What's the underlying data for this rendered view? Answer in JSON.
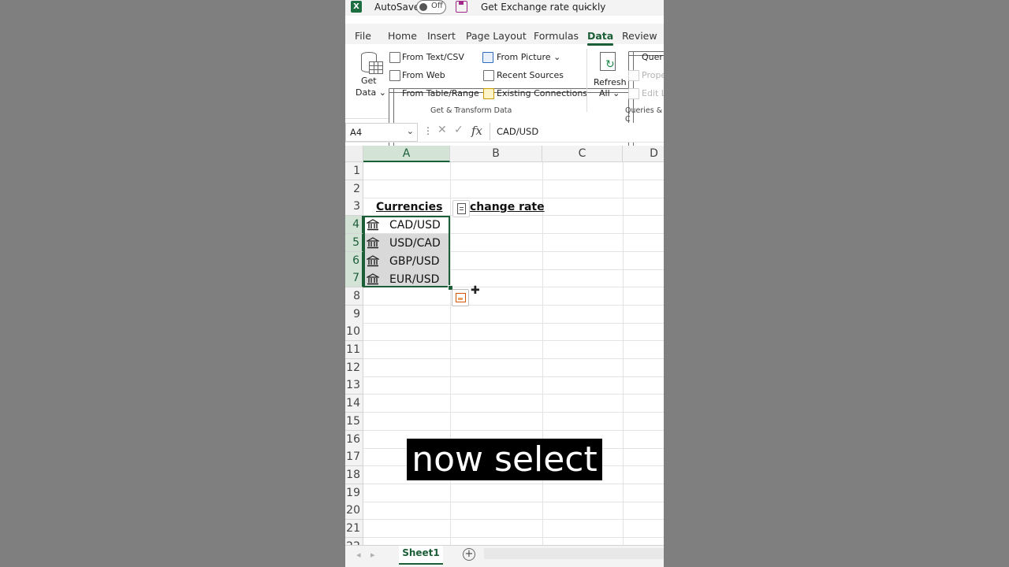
{
  "titlebar": {
    "autosave_label": "AutoSave",
    "autosave_state": "Off",
    "doc_title": "Get Exchange rate quickly",
    "chevron": "⌄"
  },
  "tabs": [
    "File",
    "Home",
    "Insert",
    "Page Layout",
    "Formulas",
    "Data",
    "Review"
  ],
  "active_tab": "Data",
  "ribbon": {
    "get_data_line1": "Get",
    "get_data_line2": "Data ⌄",
    "from_text_csv": "From Text/CSV",
    "from_web": "From Web",
    "from_table_range": "From Table/Range",
    "from_picture": "From Picture ⌄",
    "recent_sources": "Recent Sources",
    "existing_connections": "Existing Connections",
    "group_get_transform": "Get & Transform Data",
    "refresh_line1": "Refresh",
    "refresh_line2": "All ⌄",
    "queries_trunc": "Queri",
    "properties_trunc": "Prope",
    "edit_links_trunc": "Edit L",
    "group_queries_trunc": "Queries & C"
  },
  "formula_bar": {
    "name_box": "A4",
    "formula": "CAD/USD",
    "fx": "fx"
  },
  "sheet": {
    "columns": [
      "A",
      "B",
      "C",
      "D"
    ],
    "selected_column": "A",
    "rows": [
      "1",
      "2",
      "3",
      "4",
      "5",
      "6",
      "7",
      "8",
      "9",
      "10",
      "11",
      "12",
      "13",
      "14",
      "15",
      "16",
      "17",
      "18",
      "19",
      "20",
      "21",
      "22"
    ],
    "selected_rows": [
      "4",
      "5",
      "6",
      "7"
    ],
    "header_a3": "Currencies",
    "header_b3": "change rate",
    "currencies": [
      "CAD/USD",
      "USD/CAD",
      "GBP/USD",
      "EUR/USD"
    ]
  },
  "sheet_tabs": {
    "active": "Sheet1",
    "add": "+"
  },
  "caption": "now select"
}
